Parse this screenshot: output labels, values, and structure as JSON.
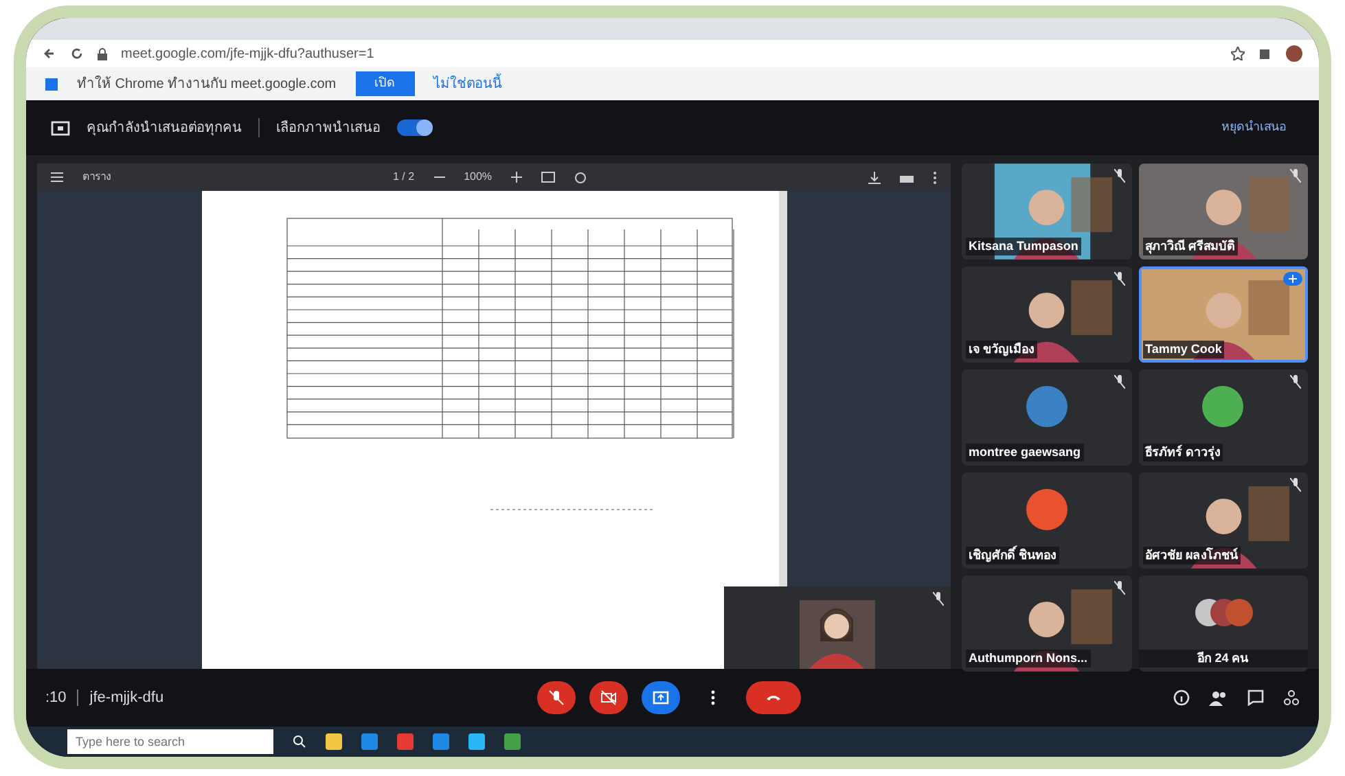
{
  "browser": {
    "url": "meet.google.com/jfe-mjjk-dfu?authuser=1",
    "infobar": {
      "message": "ทำให้ Chrome ทำงานกับ meet.google.com",
      "button": "เปิด",
      "link": "ไม่ใช่ตอนนี้"
    }
  },
  "presenting_bar": {
    "message": "คุณกำลังนำเสนอต่อทุกคน",
    "toggle_label": "เลือกภาพนำเสนอ",
    "toggle_on": true,
    "stop": "หยุดนำเสนอ"
  },
  "viewer": {
    "title": "ตาราง",
    "page": "1 / 2",
    "zoom": "100%"
  },
  "tiles": [
    {
      "name": "Kitsana Tumpason",
      "kind": "video",
      "muted": true,
      "speaking": false
    },
    {
      "name": "สุภาวิณี ศรีสมบัติ",
      "kind": "video",
      "muted": true,
      "speaking": false
    },
    {
      "name": "เจ ขวัญเมือง",
      "kind": "video",
      "muted": true,
      "speaking": false
    },
    {
      "name": "Tammy Cook",
      "kind": "video",
      "muted": false,
      "speaking": true
    },
    {
      "name": "montree gaewsang",
      "kind": "avatar",
      "color": "#3b82c4",
      "muted": true,
      "speaking": false
    },
    {
      "name": "ธีรภัทร์ ดาวรุ่ง",
      "kind": "avatar",
      "color": "#4caf50",
      "muted": true,
      "speaking": false
    },
    {
      "name": "เชิญศักดิ์ ชินทอง",
      "kind": "avatar",
      "color": "#e8522f",
      "muted": false,
      "speaking": false
    },
    {
      "name": "อัศวชัย ผลงโภชน์",
      "kind": "video",
      "muted": true,
      "speaking": false
    },
    {
      "name": "Authumporn Nons...",
      "kind": "video",
      "muted": true,
      "speaking": false
    },
    {
      "name": "อีก 24 คน",
      "kind": "more",
      "muted": false,
      "speaking": false
    }
  ],
  "self_view": {
    "muted": true
  },
  "controls": {
    "time": ":10",
    "code": "jfe-mjjk-dfu",
    "buttons": [
      {
        "kind": "mic",
        "on": false
      },
      {
        "kind": "camera",
        "on": false
      },
      {
        "kind": "present",
        "on": true
      },
      {
        "kind": "more",
        "on": true
      },
      {
        "kind": "leave",
        "on": true
      }
    ]
  },
  "taskbar": {
    "search_placeholder": "Type here to search"
  }
}
